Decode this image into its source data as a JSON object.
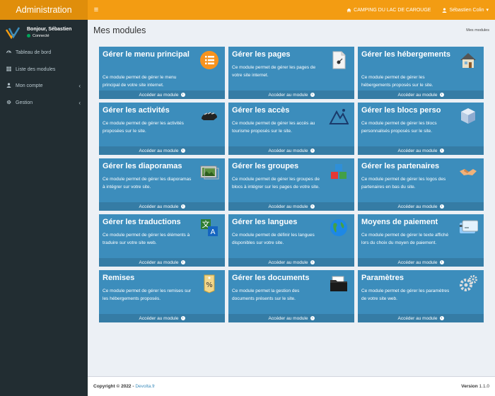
{
  "app": {
    "brand": "Administration",
    "campsite": "CAMPING DU LAC DE CAROUGE",
    "user_menu": "Sébastien Colin"
  },
  "sidebar": {
    "greeting": "Bonjour, Sébastien",
    "status": "Connecté",
    "items": [
      {
        "label": "Tableau de bord",
        "icon": "dashboard-icon",
        "chevron": ""
      },
      {
        "label": "Liste des modules",
        "icon": "grid-icon",
        "chevron": ""
      },
      {
        "label": "Mon compte",
        "icon": "user-icon",
        "chevron": "‹"
      },
      {
        "label": "Gestion",
        "icon": "gear-icon",
        "chevron": "‹"
      }
    ]
  },
  "page": {
    "title": "Mes modules",
    "breadcrumb": "Mes modules"
  },
  "modules": [
    {
      "title": "Gérer le menu principal",
      "desc": "Ce module permet de gérer le menu principal de votre site internet.",
      "icon": "menu-list-icon",
      "link": "Accéder au module"
    },
    {
      "title": "Gérer les pages",
      "desc": "Ce module permet de gérer les pages de votre site internet.",
      "icon": "page-icon",
      "link": "Accéder au module"
    },
    {
      "title": "Gérer les hébergements",
      "desc": "Ce module permet de gérer les hébergements proposés sur le site.",
      "icon": "house-icon",
      "link": "Accéder au module"
    },
    {
      "title": "Gérer les activités",
      "desc": "Ce module permet de gérer les activités proposées sur le site.",
      "icon": "bike-helmet-icon",
      "link": "Accéder au module"
    },
    {
      "title": "Gérer les accès",
      "desc": "Ce module permet de gérer les accès au tourisme proposés sur le site.",
      "icon": "mountain-icon",
      "link": "Accéder au module"
    },
    {
      "title": "Gérer les blocs perso",
      "desc": "Ce module permet de gérer les blocs personnalisés proposés sur le site.",
      "icon": "blocks-icon",
      "link": "Accéder au module"
    },
    {
      "title": "Gérer les diaporamas",
      "desc": "Ce module permet de gérer les diaporamas à intégrer sur votre site.",
      "icon": "slideshow-icon",
      "link": "Accéder au module"
    },
    {
      "title": "Gérer les groupes",
      "desc": "Ce module permet de gérer les groupes de blocs à intégrer sur les pages de votre site.",
      "icon": "cubes-icon",
      "link": "Accéder au module"
    },
    {
      "title": "Gérer les partenaires",
      "desc": "Ce module permet de gérer les logos des partenaires en bas du site.",
      "icon": "handshake-icon",
      "link": "Accéder au module"
    },
    {
      "title": "Gérer les traductions",
      "desc": "Ce module permet de gérer les éléments à traduire sur votre site web.",
      "icon": "translate-icon",
      "link": "Accéder au module"
    },
    {
      "title": "Gérer les langues",
      "desc": "Ce module permet de définir les langues disponibles sur votre site.",
      "icon": "globe-icon",
      "link": "Accéder au module"
    },
    {
      "title": "Moyens de paiement",
      "desc": "Ce module permet de gérer le texte affiché lors du choix du moyen de paiement.",
      "icon": "credit-card-icon",
      "link": "Accéder au module"
    },
    {
      "title": "Remises",
      "desc": "Ce module permet de gérer les remises sur les hébergements proposés.",
      "icon": "discount-tag-icon",
      "link": "Accéder au module"
    },
    {
      "title": "Gérer les documents",
      "desc": "Ce module permet la gestion des documents présents sur le site.",
      "icon": "folder-icon",
      "link": "Accéder au module"
    },
    {
      "title": "Paramètres",
      "desc": "Ce module permet de gérer les paramètres de votre site web.",
      "icon": "settings-gears-icon",
      "link": "Accéder au module"
    }
  ],
  "footer": {
    "copyright": "Copyright © 2022 -",
    "company": "Devolta.fr",
    "version_label": "Version",
    "version": "1.1.0"
  },
  "colors": {
    "brand": "#e08e0b",
    "navbar": "#f39c12",
    "sidebar": "#222d32",
    "card": "#3c8dbc",
    "card_footer": "#357ca5"
  }
}
